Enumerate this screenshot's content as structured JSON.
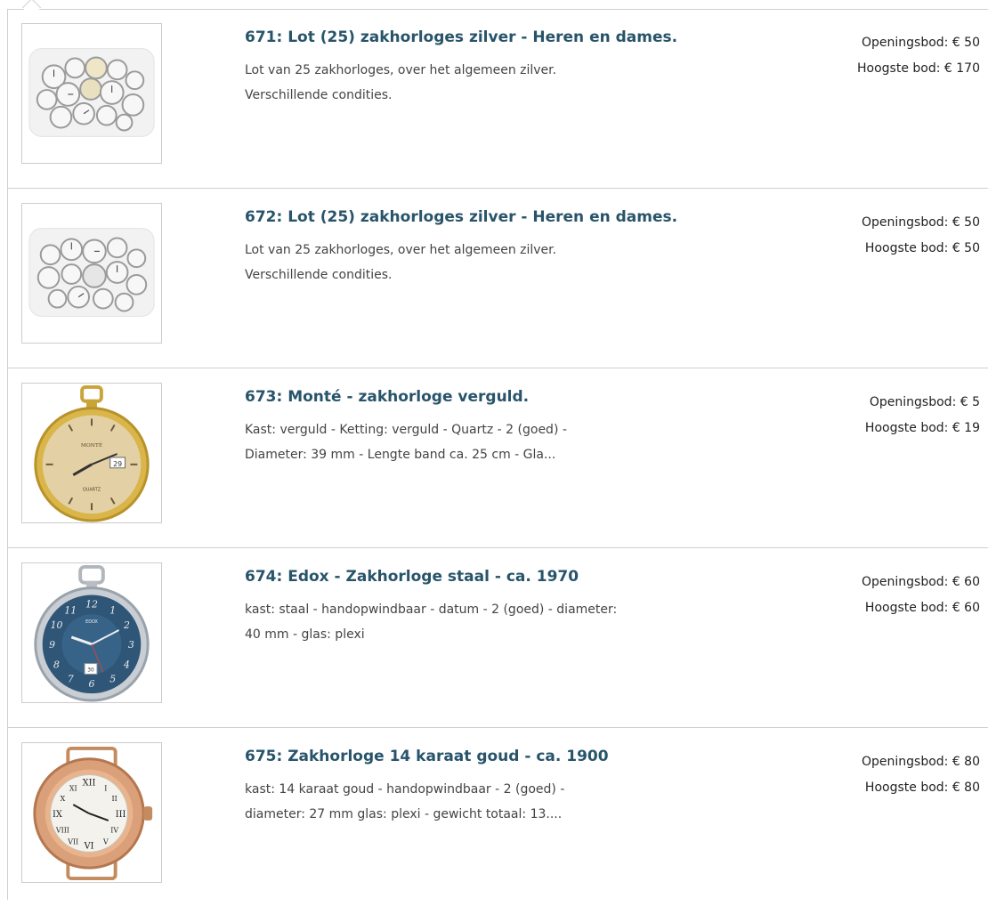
{
  "lots": [
    {
      "title": "671: Lot (25) zakhorloges zilver - Heren en dames.",
      "description_lines": [
        "Lot van 25 zakhorloges, over het algemeen zilver.",
        "Verschillende condities."
      ],
      "opening_bid": "Openingsbod: € 50",
      "highest_bid": "Hoogste bod: € 170",
      "image": "silver-pocket-watches-lot-image"
    },
    {
      "title": "672: Lot (25) zakhorloges zilver - Heren en dames.",
      "description_lines": [
        "Lot van 25 zakhorloges, over het algemeen zilver.",
        "Verschillende condities."
      ],
      "opening_bid": "Openingsbod: € 50",
      "highest_bid": "Hoogste bod: € 50",
      "image": "silver-pocket-watches-lot-image"
    },
    {
      "title": "673: Monté - zakhorloge verguld.",
      "description_lines": [
        "Kast: verguld - Ketting: verguld - Quartz - 2 (goed) -",
        "Diameter: 39 mm - Lengte band ca. 25 cm - Gla..."
      ],
      "opening_bid": "Openingsbod: € 5",
      "highest_bid": "Hoogste bod: € 19",
      "image": "gold-pocket-watch-image",
      "dial_text": [
        "MONTÉ",
        "QUARTZ",
        "29"
      ]
    },
    {
      "title": "674: Edox - Zakhorloge staal - ca. 1970",
      "description_lines": [
        "kast: staal - handopwindbaar - datum - 2 (goed) - diameter:",
        "40 mm - glas: plexi"
      ],
      "opening_bid": "Openingsbod: € 60",
      "highest_bid": "Hoogste bod: € 60",
      "image": "blue-dial-steel-pocket-watch-image",
      "dial_text": [
        "EDOX",
        "12",
        "1",
        "2",
        "3",
        "4",
        "5",
        "6",
        "7",
        "8",
        "9",
        "10",
        "11",
        "30"
      ]
    },
    {
      "title": "675: Zakhorloge 14 karaat goud - ca. 1900",
      "description_lines": [
        "kast: 14 karaat goud - handopwindbaar - 2 (goed) -",
        "diameter: 27 mm glas: plexi - gewicht totaal: 13...."
      ],
      "opening_bid": "Openingsbod: € 80",
      "highest_bid": "Hoogste bod: € 80",
      "image": "gold-wrist-watch-image"
    }
  ],
  "colors": {
    "title": "#28546a",
    "border": "#cfcfcf"
  }
}
